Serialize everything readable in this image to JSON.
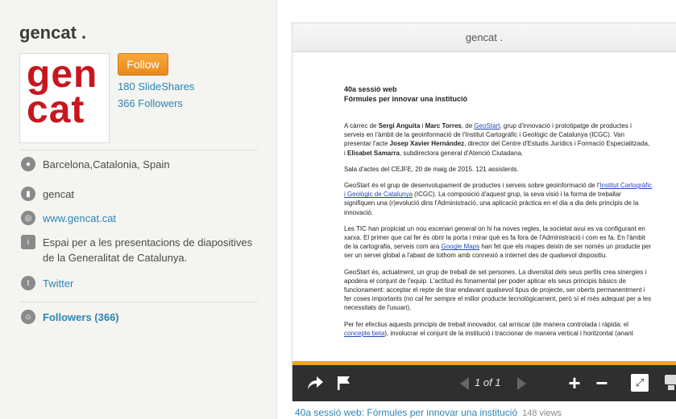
{
  "profile": {
    "name": "gencat .",
    "logo_lines": [
      "gen",
      "cat"
    ],
    "follow_label": "Follow",
    "slideshares": "180 SlideShares",
    "followers": "366 Followers",
    "location": "Barcelona,Catalonia, Spain",
    "organization": "gencat",
    "website": "www.gencat.cat",
    "description": "Espai per a les presentacions de diapositives de la Generalitat de Catalunya.",
    "twitter": "Twitter",
    "followers_link": "Followers (366)"
  },
  "viewer": {
    "title": "gencat .",
    "page_indicator": "1 of 1",
    "doc": {
      "heading1": "40a sessió web",
      "heading2": "Fórmules per innovar una institució",
      "p1_a": "A càrrec de ",
      "p1_b": "Sergi Anguita",
      "p1_c": " i ",
      "p1_d": "Marc Torres",
      "p1_e": ", de ",
      "p1_f": "GeoStart",
      "p1_g": ", grup d'innovació i prototipatge de productes i serveis en l'àmbit de la geoinformació de l'Institut Cartogràfic i Geològic de Catalunya (ICGC). Van presentar l'acte ",
      "p1_h": "Josep Xavier Hernández",
      "p1_i": ", director del Centre d'Estudis Jurídics i Formació Especialitzada, i ",
      "p1_j": "Elisabet Samarra",
      "p1_k": ", subdirectora general d'Atenció Ciutadana.",
      "p2": "Sala d'actes del CEJFE, 20 de maig de 2015. 121 assistents.",
      "p3_a": "GeoStart és el grup de desenvolupament de productes i serveis sobre geoinformació de l'",
      "p3_b": "Institut Cartogràfic i Geològic de Catalunya",
      "p3_c": " (ICGC). La composició d'aquest grup, la seva visió i la forma de treballar signifiquen una (r)evolució dins l'Administració, una aplicació pràctica en el dia a dia dels principis de la innovació.",
      "p4_a": "Les TIC han propiciat un nou escenari general on hi ha noves regles, la societat avui es va configurant en xarxa. El primer que cal fer és obrir la porta i mirar què es fa fora de l'Administració i com es fa. En l'àmbit de la cartografia, serveis com ara ",
      "p4_b": "Google Maps",
      "p4_c": " han fet que els mapes deixin de ser només un producte per ser un servei global a l'abast de tothom amb connexió a internet des de qualsevol dispositiu.",
      "p5": "GeoStart és, actualment, un grup de treball de set persones. La diversitat dels seus perfils crea sinergies i apodera el conjunt de l'equip. L'actitud és fonamental per poder aplicar els seus principis bàsics de funcionament: acceptar el repte de tirar endavant qualsevol tipus de projecte, ser oberts permanentment i fer coses importants (no cal fer sempre el millor producte tecnològicament, però sí el més adequat per a les necessitats de l'usuari).",
      "p6_a": "Per fer efectius aquests principis de treball innovador, cal arriscar (de manera controlada i ràpida: el ",
      "p6_b": "concepte beta",
      "p6_c": "), involucrar el conjunt de la institució i traccionar de manera vertical i horitzontal (anant"
    }
  },
  "caption": {
    "title": "40a sessió web: Fórmules per innovar una institució",
    "views": "148 views"
  },
  "colors": {
    "accent_orange": "#f0a51d",
    "link_blue": "#2a86b4",
    "logo_red": "#c8161e"
  },
  "icons": [
    "location-icon",
    "building-icon",
    "globe-icon",
    "info-icon",
    "twitter-icon",
    "followers-icon",
    "share-icon",
    "flag-icon",
    "zoom-in-icon",
    "zoom-out-icon",
    "fullscreen-icon"
  ]
}
